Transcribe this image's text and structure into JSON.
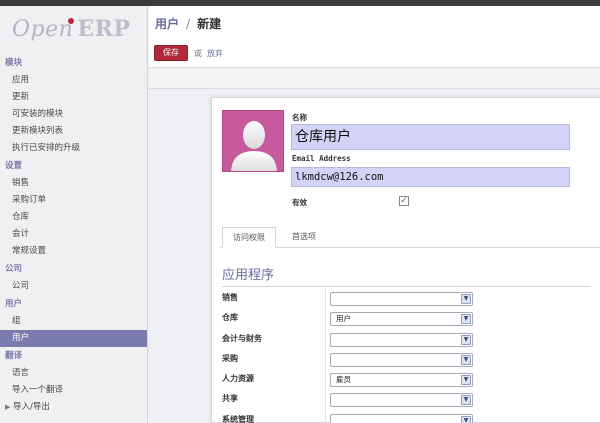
{
  "sidebar": {
    "logo": {
      "open": "Open",
      "erp": "ERP"
    },
    "sections": [
      {
        "title": "模块",
        "items": [
          "应用",
          "更新",
          "可安装的模块",
          "更新模块列表",
          "执行已安排的升级"
        ]
      },
      {
        "title": "设置",
        "items": [
          "销售",
          "采购订单",
          "仓库",
          "会计",
          "常规设置"
        ]
      },
      {
        "title": "公司",
        "items": [
          "公司"
        ]
      },
      {
        "title": "用户",
        "items": [
          "组",
          "用户"
        ]
      },
      {
        "title": "翻译",
        "items": [
          "语言",
          "导入一个翻译",
          "导入/导出"
        ]
      }
    ]
  },
  "header": {
    "breadcrumb_parent": "用户",
    "separator": "/",
    "breadcrumb_current": "新建",
    "save_label": "保存",
    "or_label": "或",
    "discard_label": "放弃"
  },
  "form": {
    "name_label": "名称",
    "name_value": "仓库用户",
    "email_label": "Email Address",
    "email_value": "lkmdcw@126.com",
    "active_label": "有效",
    "active_checked": true,
    "check_mark": "✓",
    "tabs": [
      "访问权限",
      "首选项"
    ],
    "section_title": "应用程序",
    "dropdown_icon": "chevron-down-icon",
    "rows": [
      {
        "label": "销售",
        "value": ""
      },
      {
        "label": "仓库",
        "value": "用户"
      },
      {
        "label": "会计与财务",
        "value": ""
      },
      {
        "label": "采购",
        "value": ""
      },
      {
        "label": "人力资源",
        "value": "雇员"
      },
      {
        "label": "共享",
        "value": ""
      },
      {
        "label": "系统管理",
        "value": ""
      }
    ]
  },
  "colors": {
    "accent": "#7c7bad",
    "save_button": "#b22a3a",
    "required_field": "#d3d3f8",
    "avatar_bg": "#c75a9c"
  }
}
